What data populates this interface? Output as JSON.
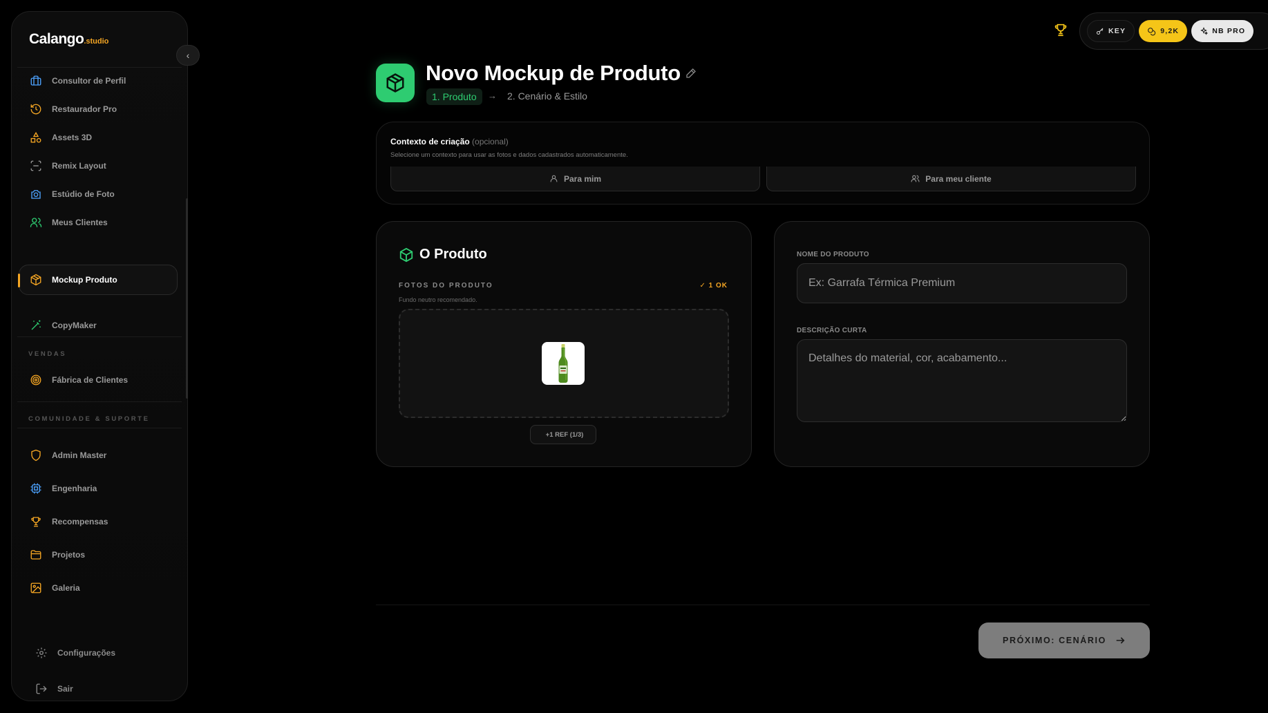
{
  "brand": {
    "name": "Calango",
    "suffix": ".studio"
  },
  "sidebar": {
    "items": [
      {
        "label": "Consultor de Perfil",
        "icon": "briefcase-icon",
        "color": "#4da3ff"
      },
      {
        "label": "Restaurador Pro",
        "icon": "history-icon",
        "color": "#f5a623"
      },
      {
        "label": "Assets 3D",
        "icon": "shapes-icon",
        "color": "#f5a623"
      },
      {
        "label": "Remix Layout",
        "icon": "scan-icon",
        "color": "#9a9a9a"
      },
      {
        "label": "Estúdio de Foto",
        "icon": "camera-icon",
        "color": "#4da3ff"
      },
      {
        "label": "Meus Clientes",
        "icon": "users-icon",
        "color": "#2ecc71"
      },
      {
        "label": "Mockup Produto",
        "icon": "box-icon",
        "color": "#f5a623",
        "active": true
      },
      {
        "label": "CopyMaker",
        "icon": "wand-icon",
        "color": "#2ecc71"
      }
    ],
    "section_sales": "VENDAS",
    "sales_items": [
      {
        "label": "Fábrica de Clientes",
        "icon": "target-icon",
        "color": "#f5a623"
      }
    ],
    "section_community": "COMUNIDADE & SUPORTE",
    "community_items": [
      {
        "label": "Admin Master",
        "icon": "shield-icon",
        "color": "#f5a623"
      },
      {
        "label": "Engenharia",
        "icon": "cpu-icon",
        "color": "#4da3ff"
      },
      {
        "label": "Recompensas",
        "icon": "trophy-icon",
        "color": "#f5a623"
      },
      {
        "label": "Projetos",
        "icon": "folder-icon",
        "color": "#f5a623"
      },
      {
        "label": "Galeria",
        "icon": "image-icon",
        "color": "#f5a623"
      }
    ],
    "settings_label": "Configurações",
    "logout_label": "Sair"
  },
  "topbar": {
    "key_label": "KEY",
    "credits_label": "9,2K",
    "plan_label": "NB PRO"
  },
  "header": {
    "title": "Novo Mockup de Produto",
    "step1": "1. Produto",
    "step2": "2. Cenário & Estilo"
  },
  "context": {
    "title": "Contexto de criação",
    "optional": "(opcional)",
    "subtitle": "Selecione um contexto para usar as fotos e dados cadastrados automaticamente.",
    "option_me": "Para mim",
    "option_client": "Para meu cliente"
  },
  "product": {
    "title": "O Produto",
    "photos_label": "FOTOS DO PRODUTO",
    "ok_badge": "✓ 1 OK",
    "photos_hint": "Fundo neutro recomendado.",
    "ref_button": "+1 REF (1/3)"
  },
  "info": {
    "name_label": "NOME DO PRODUTO",
    "name_placeholder": "Ex: Garrafa Térmica Premium",
    "name_value": "",
    "desc_label": "DESCRIÇÃO CURTA",
    "desc_placeholder": "Detalhes do material, cor, acabamento...",
    "desc_value": ""
  },
  "footer": {
    "next_label": "PRÓXIMO: CENÁRIO"
  },
  "colors": {
    "accent_green": "#2ecc71",
    "accent_orange": "#f5a623",
    "credits_yellow": "#f5c518"
  }
}
